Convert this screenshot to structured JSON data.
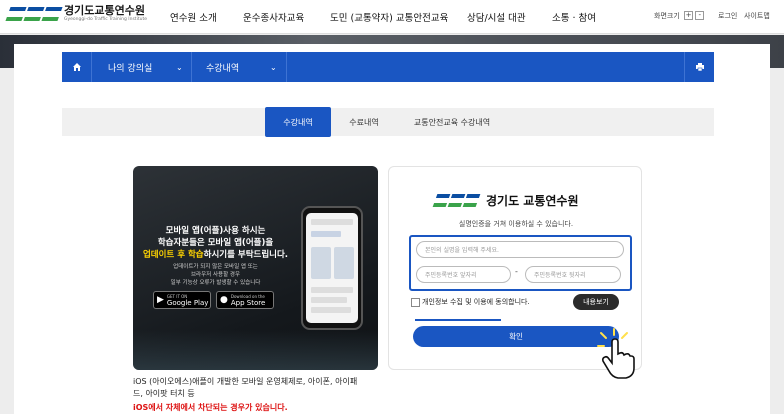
{
  "header": {
    "logo_title": "경기도교통연수원",
    "logo_subtitle": "Gyeonggi-do Traffic Training Institute",
    "menu": [
      "연수원 소개",
      "운수종사자교육",
      "도민 (교통약자) 교통안전교육",
      "상담/시설 대관",
      "소통 · 참여"
    ],
    "font_size_label": "화면크기",
    "font_plus": "+",
    "font_minus": "-",
    "login": "로그인",
    "sitemap": "사이트맵"
  },
  "navbar": {
    "home_icon": "home-icon",
    "crumb1": "나의 강의실",
    "crumb2": "수강내역",
    "print_icon": "print-icon"
  },
  "tabs": [
    {
      "label": "수강내역",
      "active": true
    },
    {
      "label": "수료내역",
      "active": false
    },
    {
      "label": "교통안전교육 수강내역",
      "active": false
    }
  ],
  "app_banner": {
    "line1": "모바일 앱(어플)사용 하시는",
    "line2": "학습자분들은 모바일 앱(어플)을",
    "line3_highlight": "업데이트 후 학습",
    "line3_rest": "하시기를 부탁드립니다.",
    "sub1": "업데이트가 되지 않은 모바일 앱 또는",
    "sub2": "브라우저 사용할 경우",
    "sub3": "일부 기능상 오류가 발생할 수 있습니다",
    "google_small": "GET IT ON",
    "google": "Google Play",
    "apple_small": "Download on the",
    "apple": "App Store"
  },
  "notes": {
    "line1": "iOS (아이오에스)애플이 개발한 모바일 운영체제로, 아이폰, 아이패",
    "line2": "드, 아이팟 터치 등",
    "warning": "iOS에서 자체에서 차단되는 경우가 있습니다."
  },
  "auth": {
    "title": "경기도 교통연수원",
    "subtitle": "실명인증을 거쳐 이용하실 수 있습니다.",
    "name_placeholder": "본인의 실명을 입력해 주세요.",
    "rrn_front_placeholder": "주민등록번호 앞자리",
    "rrn_back_placeholder": "주민등록번호 뒷자리",
    "dash": "-",
    "agree": "개인정보 수집 및 이용에 동의합니다.",
    "detail_button": "내용보기",
    "confirm_button": "확인"
  },
  "colors": {
    "primary": "#1a56c2",
    "warning": "#dd1111",
    "highlight": "#ffd400"
  }
}
